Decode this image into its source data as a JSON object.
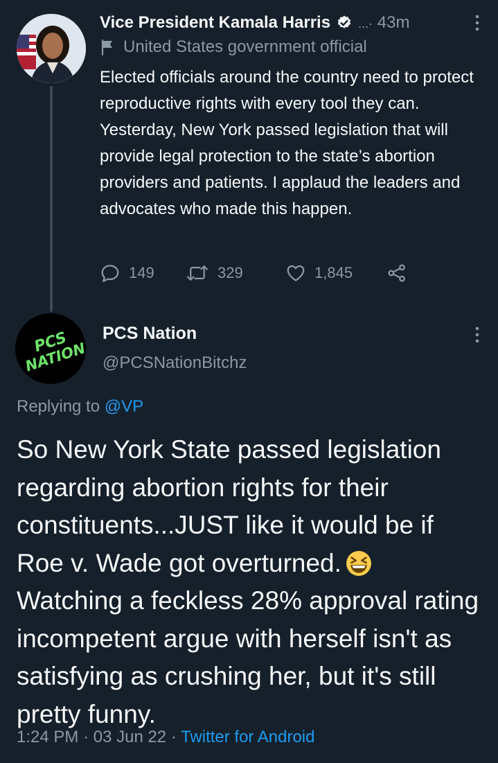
{
  "tweet1": {
    "author_name": "Vice President Kamala Harris",
    "time": "43m",
    "time_prefix": "...·",
    "label": "United States government official",
    "text": "Elected officials around the country need to protect reproductive rights with every tool they can. Yesterday, New York passed legislation that will provide legal protection to the state’s abortion providers and patients. I applaud the leaders and advocates who made this happen.",
    "replies": "149",
    "retweets": "329",
    "likes": "1,845",
    "icons": {
      "verified": "verified-badge-icon",
      "label": "flag-icon",
      "more": "more-vertical-icon",
      "reply": "reply-icon",
      "retweet": "retweet-icon",
      "like": "heart-icon",
      "share": "share-icon"
    }
  },
  "tweet2": {
    "author_name": "PCS Nation",
    "handle": "@PCSNationBitchz",
    "avatar_text_line1": "PCS",
    "avatar_text_line2": "NATION",
    "replying_prefix": "Replying to",
    "replying_to": "@VP",
    "text_before_emoji": "So New York State passed legislation regarding abortion rights for their constituents...JUST like it would be if Roe v. Wade got overturned.",
    "text_after_emoji": "Watching a feckless 28% approval rating incompetent argue with herself isn't as satisfying as crushing her, but it's still pretty funny.",
    "emoji": "grinning-squinting-face-emoji",
    "time": "1:24 PM",
    "separator": "·",
    "date": "03 Jun 22",
    "source": "Twitter for Android"
  },
  "colors": {
    "background": "#15202b",
    "text": "#f7f9f9",
    "muted": "#8b98a5",
    "link": "#1d9bf0",
    "avatar2_text": "#6ee36a"
  }
}
